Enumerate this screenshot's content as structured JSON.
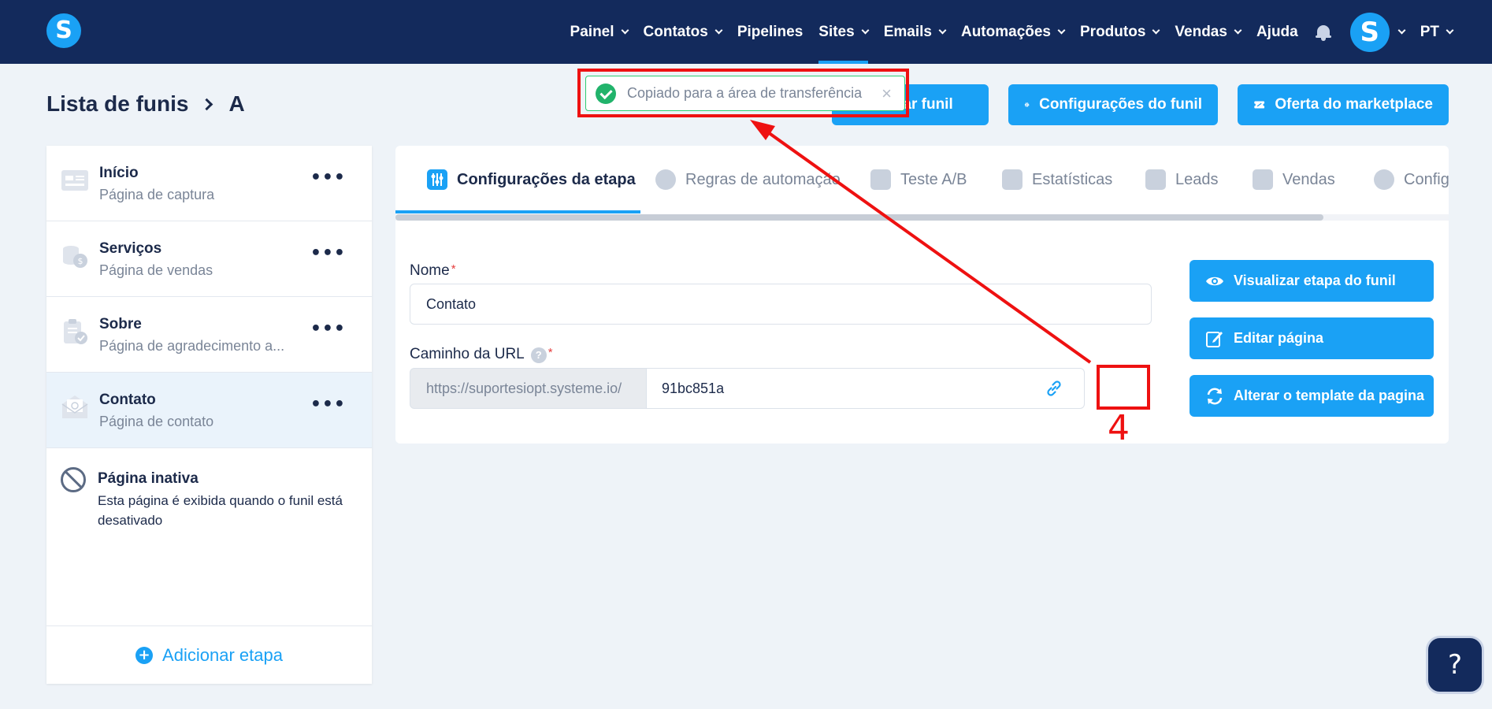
{
  "brand": {
    "logo_letter": "S",
    "accent": "#1aa1f5",
    "nav_bg": "#132a5c"
  },
  "nav": {
    "items": [
      {
        "label": "Painel",
        "dropdown": true
      },
      {
        "label": "Contatos",
        "dropdown": true
      },
      {
        "label": "Pipelines",
        "dropdown": false
      },
      {
        "label": "Sites",
        "dropdown": true,
        "active": true
      },
      {
        "label": "Emails",
        "dropdown": true
      },
      {
        "label": "Automações",
        "dropdown": true
      },
      {
        "label": "Produtos",
        "dropdown": true
      },
      {
        "label": "Vendas",
        "dropdown": true
      },
      {
        "label": "Ajuda",
        "dropdown": false
      }
    ],
    "avatar_letter": "S",
    "language": "PT"
  },
  "breadcrumb": {
    "root": "Lista de funis",
    "current": "A"
  },
  "header_buttons": {
    "view_funnel": "Visualizar funil",
    "funnel_settings": "Configurações do funil",
    "marketplace_offer": "Oferta do marketplace"
  },
  "toast": {
    "message": "Copiado para a área de transferência",
    "close": "×"
  },
  "steps": [
    {
      "title": "Início",
      "subtitle": "Página de captura",
      "icon": "capture-page-icon"
    },
    {
      "title": "Serviços",
      "subtitle": "Página de vendas",
      "icon": "sales-page-icon"
    },
    {
      "title": "Sobre",
      "subtitle": "Página de agradecimento a...",
      "icon": "thank-you-page-icon"
    },
    {
      "title": "Contato",
      "subtitle": "Página de contato",
      "icon": "contact-page-icon",
      "selected": true
    }
  ],
  "inactive_page": {
    "title": "Página inativa",
    "description": "Esta página é exibida quando o funil está desativado"
  },
  "add_step": "Adicionar etapa",
  "tabs": [
    {
      "label": "Configurações da etapa",
      "active": true
    },
    {
      "label": "Regras de automação"
    },
    {
      "label": "Teste A/B"
    },
    {
      "label": "Estatísticas"
    },
    {
      "label": "Leads"
    },
    {
      "label": "Vendas"
    },
    {
      "label": "Configurações"
    }
  ],
  "form": {
    "name_label": "Nome",
    "name_value": "Contato",
    "url_label": "Caminho da URL",
    "url_prefix": "https://suportesiopt.systeme.io/",
    "url_value": "91bc851a",
    "required_mark": "*",
    "help_mark": "?"
  },
  "panel_buttons": {
    "view_step": "Visualizar etapa do funil",
    "edit_page": "Editar página",
    "change_template": "Alterar o template da pagina"
  },
  "annotation": {
    "number": "4"
  },
  "help_button": "?"
}
